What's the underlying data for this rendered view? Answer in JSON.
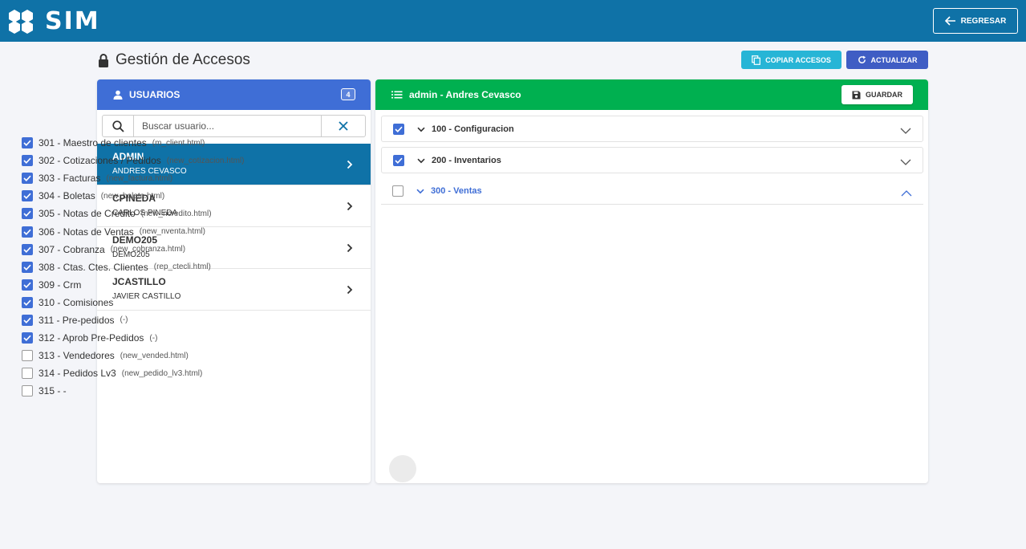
{
  "app": {
    "logo_text": "SIM"
  },
  "topbar": {
    "back_label": "REGRESAR"
  },
  "page": {
    "title": "Gestión de Accesos",
    "copy_label": "COPIAR ACCESOS",
    "refresh_label": "ACTUALIZAR"
  },
  "users": {
    "header": "USUARIOS",
    "count": "4",
    "search_placeholder": "Buscar usuario...",
    "items": [
      {
        "code": "ADMIN",
        "name": "ANDRES CEVASCO",
        "active": true
      },
      {
        "code": "CPINEDA",
        "name": "CARLOS PINEDA",
        "active": false
      },
      {
        "code": "DEMO205",
        "name": "DEMO205",
        "active": false
      },
      {
        "code": "JCASTILLO",
        "name": "JAVIER CASTILLO",
        "active": false
      }
    ]
  },
  "access": {
    "header": "admin - Andres Cevasco",
    "save_label": "GUARDAR",
    "groups": [
      {
        "label": "100 - Configuracion",
        "checked": true,
        "open": false
      },
      {
        "label": "200 - Inventarios",
        "checked": true,
        "open": false
      },
      {
        "label": "300 - Ventas",
        "checked": false,
        "open": true
      }
    ],
    "items": [
      {
        "label": "301 - Maestro de clientes",
        "file": "(m_client.html)",
        "checked": true
      },
      {
        "label": "302 - Cotizaciones / Pedidos",
        "file": "(new_cotizacion.html)",
        "checked": true
      },
      {
        "label": "303 - Facturas",
        "file": "(new_factura.html)",
        "checked": true
      },
      {
        "label": "304 - Boletas",
        "file": "(new_boleta.html)",
        "checked": true
      },
      {
        "label": "305 - Notas de Credito",
        "file": "(new_ncredito.html)",
        "checked": true
      },
      {
        "label": "306 - Notas de Ventas",
        "file": "(new_nventa.html)",
        "checked": true
      },
      {
        "label": "307 - Cobranza",
        "file": "(new_cobranza.html)",
        "checked": true
      },
      {
        "label": "308 - Ctas. Ctes. Clientes",
        "file": "(rep_ctecli.html)",
        "checked": true
      },
      {
        "label": "309 - Crm",
        "file": "",
        "checked": true
      },
      {
        "label": "310 - Comisiones",
        "file": "",
        "checked": true
      },
      {
        "label": "311 - Pre-pedidos",
        "file": "(-)",
        "checked": true
      },
      {
        "label": "312 - Aprob Pre-Pedidos",
        "file": "(-)",
        "checked": true
      },
      {
        "label": "313 - Vendedores",
        "file": "(new_vended.html)",
        "checked": false
      },
      {
        "label": "314 - Pedidos Lv3",
        "file": "(new_pedido_lv3.html)",
        "checked": false
      },
      {
        "label": "315 - -",
        "file": "",
        "checked": false
      }
    ]
  },
  "colors": {
    "topbar": "#0f72a7",
    "users_header": "#3f6ed6",
    "access_header": "#00b050",
    "copy_button": "#27b5d6",
    "refresh_button": "#3f5dc4"
  }
}
